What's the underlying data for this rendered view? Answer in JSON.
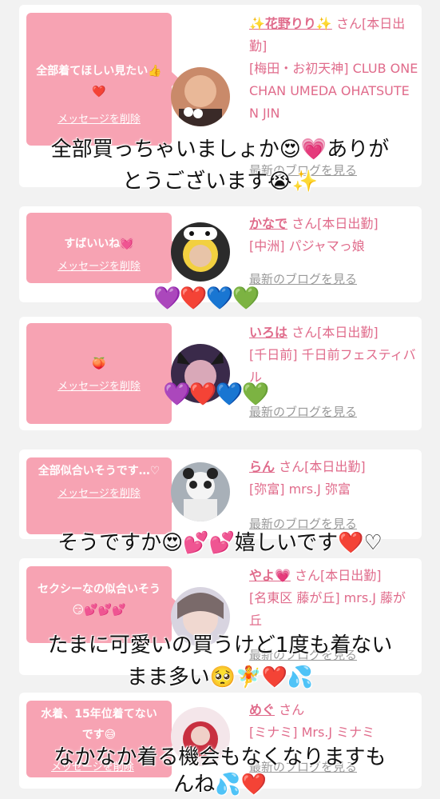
{
  "cards": [
    {
      "message": "全部着てほしい見たい👍❤️",
      "delete_label": "メッセージを削除",
      "name": "✨花野りり✨",
      "suffix": "さん[本日出勤]",
      "shop": "[梅田・お初天神] CLUB ONE CHAN UMEDA OHATSUTEN JIN",
      "blog": "最新のブログを見る"
    },
    {
      "message": "すばいいね💓",
      "delete_label": "メッセージを削除",
      "name": "かなで",
      "suffix": "さん[本日出勤]",
      "shop": "[中洲] パジャマっ娘",
      "blog": "最新のブログを見る"
    },
    {
      "message": "🍑",
      "delete_label": "メッセージを削除",
      "name": "いろは",
      "suffix": "さん[本日出勤]",
      "shop": "[千日前] 千日前フェスティバル",
      "blog": "最新のブログを見る"
    },
    {
      "message": "全部似合いそうです…♡",
      "delete_label": "メッセージを削除",
      "name": "らん",
      "suffix": "さん[本日出勤]",
      "shop": "[弥富] mrs.J 弥富",
      "blog": "最新のブログを見る"
    },
    {
      "message": "セクシーなの似合いそう😏💕💕💕",
      "delete_label": "メッセージを削除",
      "name": "やよ💗",
      "suffix": "さん[本日出勤]",
      "shop": "[名東区 藤が丘] mrs.J 藤が丘",
      "blog": "最新のブログを見る"
    },
    {
      "message": "水着、15年位着てないです😅",
      "delete_label": "メッセージを削除",
      "name": "めぐ",
      "suffix": "さん",
      "shop": "[ミナミ] Mrs.J ミナミ",
      "blog": "最新のブログを見る"
    }
  ],
  "overlays": {
    "line1a": "全部買っちゃいましょか😍💗ありが",
    "line1b": "とうございます😭✨",
    "hearts1": "💜❤️💙💚",
    "hearts2": "💜❤️💙💚",
    "line2": "そうですか😍💕💕嬉しいです❤️♡",
    "line3a": "たまに可愛いの買うけど1度も着ない",
    "line3b": "まま多い🥺🧚❤️💦",
    "line4a": "なかなか着る機会もなくなりますも",
    "line4b": "んね💦❤️"
  },
  "colors": {
    "bubble": "#f7a3b3",
    "accent": "#e06b8b",
    "background": "#f2f2f2"
  }
}
